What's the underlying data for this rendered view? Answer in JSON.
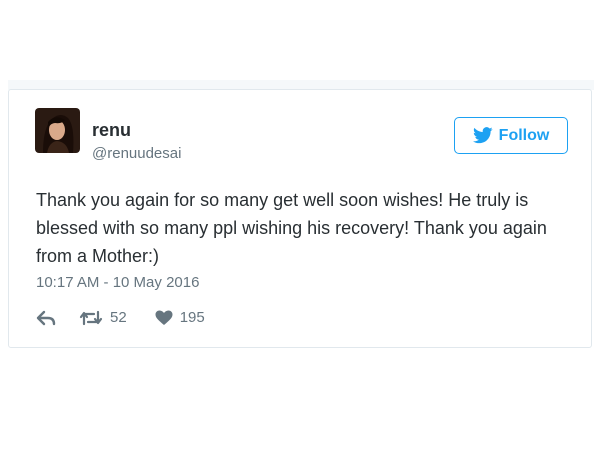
{
  "tweet": {
    "display_name": "renu",
    "handle": "@renuudesai",
    "follow_label": "Follow",
    "text": "Thank you again for so many get well soon wishes! He truly is blessed with so many ppl wishing his recovery! Thank you again from a Mother:)",
    "timestamp": "10:17 AM - 10 May 2016",
    "retweet_count": "52",
    "like_count": "195"
  },
  "colors": {
    "accent": "#1da1f2",
    "text": "#292f33",
    "muted": "#66757f",
    "border": "#e1e8ed"
  },
  "icons": [
    "twitter-bird-icon",
    "reply-icon",
    "retweet-icon",
    "heart-icon"
  ]
}
